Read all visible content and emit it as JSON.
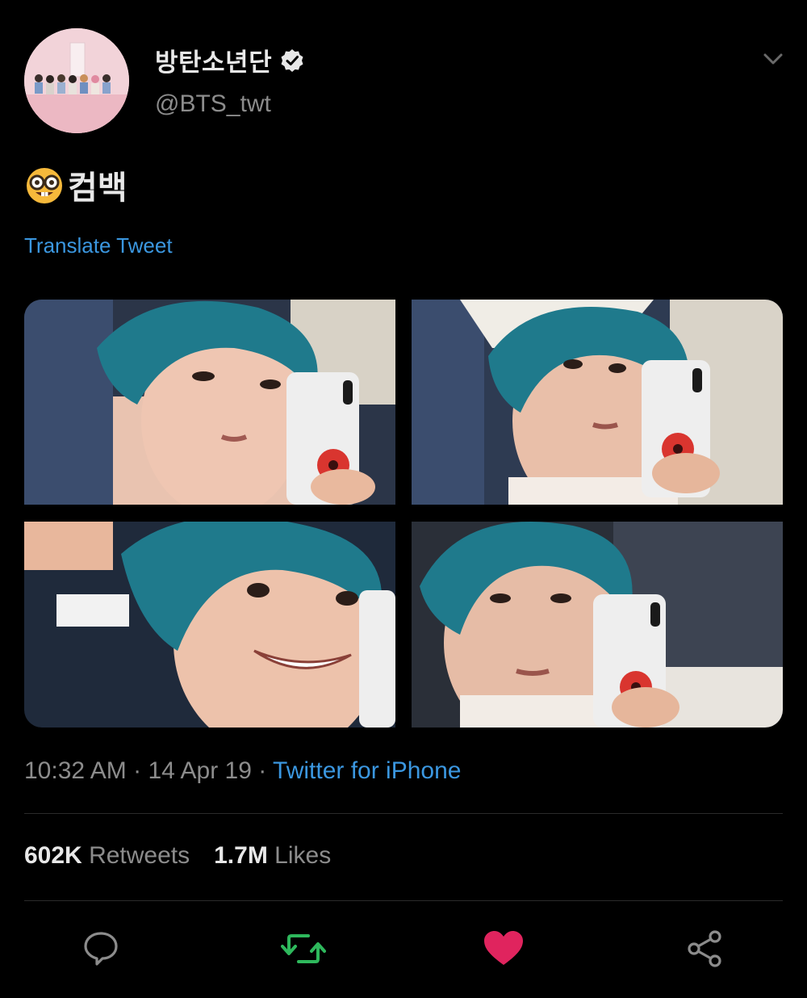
{
  "author": {
    "display_name": "방탄소년단",
    "handle": "@BTS_twt",
    "verified": true,
    "avatar_icon": "group-photo-avatar"
  },
  "tweet": {
    "emoji": "nerd-face-emoji",
    "text": "컴백",
    "translate_label": "Translate Tweet",
    "time": "10:32 AM",
    "date": "14 Apr 19",
    "separator": "·",
    "source": "Twitter for iPhone"
  },
  "stats": {
    "retweets_count": "602K",
    "retweets_label": "Retweets",
    "likes_count": "1.7M",
    "likes_label": "Likes"
  },
  "actions": [
    {
      "icon": "reply-icon",
      "color": "#8c8c8c"
    },
    {
      "icon": "retweet-icon",
      "color": "#2eb85c",
      "active": true
    },
    {
      "icon": "heart-icon",
      "color": "#e0245e",
      "active": true
    },
    {
      "icon": "share-icon",
      "color": "#8c8c8c"
    }
  ],
  "colors": {
    "background": "#000000",
    "link": "#3b97e0",
    "secondary_text": "#8c8c8c",
    "retweet_active": "#2eb85c",
    "like_active": "#e0245e",
    "hair": "#1f7a8c"
  }
}
